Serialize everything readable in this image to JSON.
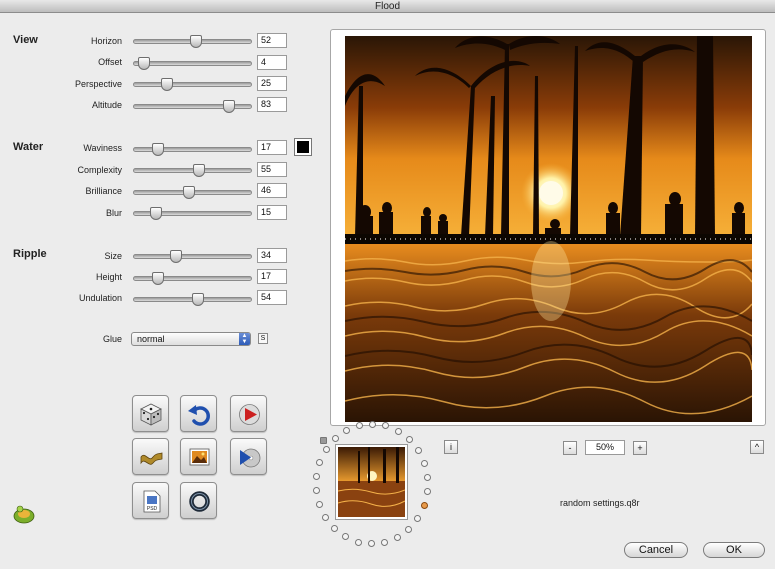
{
  "window": {
    "title": "Flood"
  },
  "sections": {
    "view": {
      "label": "View",
      "rows": [
        {
          "label": "Horizon",
          "value": "52",
          "level": 52
        },
        {
          "label": "Offset",
          "value": "4",
          "level": 4
        },
        {
          "label": "Perspective",
          "value": "25",
          "level": 25
        },
        {
          "label": "Altitude",
          "value": "83",
          "level": 83
        }
      ]
    },
    "water": {
      "label": "Water",
      "rows": [
        {
          "label": "Waviness",
          "value": "17",
          "level": 17
        },
        {
          "label": "Complexity",
          "value": "55",
          "level": 55
        },
        {
          "label": "Brilliance",
          "value": "46",
          "level": 46
        },
        {
          "label": "Blur",
          "value": "15",
          "level": 15
        }
      ]
    },
    "ripple": {
      "label": "Ripple",
      "rows": [
        {
          "label": "Size",
          "value": "34",
          "level": 34
        },
        {
          "label": "Height",
          "value": "17",
          "level": 17
        },
        {
          "label": "Undulation",
          "value": "54",
          "level": 54
        }
      ]
    }
  },
  "glue": {
    "label": "Glue",
    "selected": "normal",
    "s_label": "S"
  },
  "water_color": "#000000",
  "preview": {
    "zoom": "50%",
    "zoom_out": "-",
    "zoom_in": "+",
    "info": "i",
    "expand": "^"
  },
  "preset_file": "random settings.q8r",
  "buttons": {
    "cancel": "Cancel",
    "ok": "OK"
  },
  "psd_label": "PSD"
}
